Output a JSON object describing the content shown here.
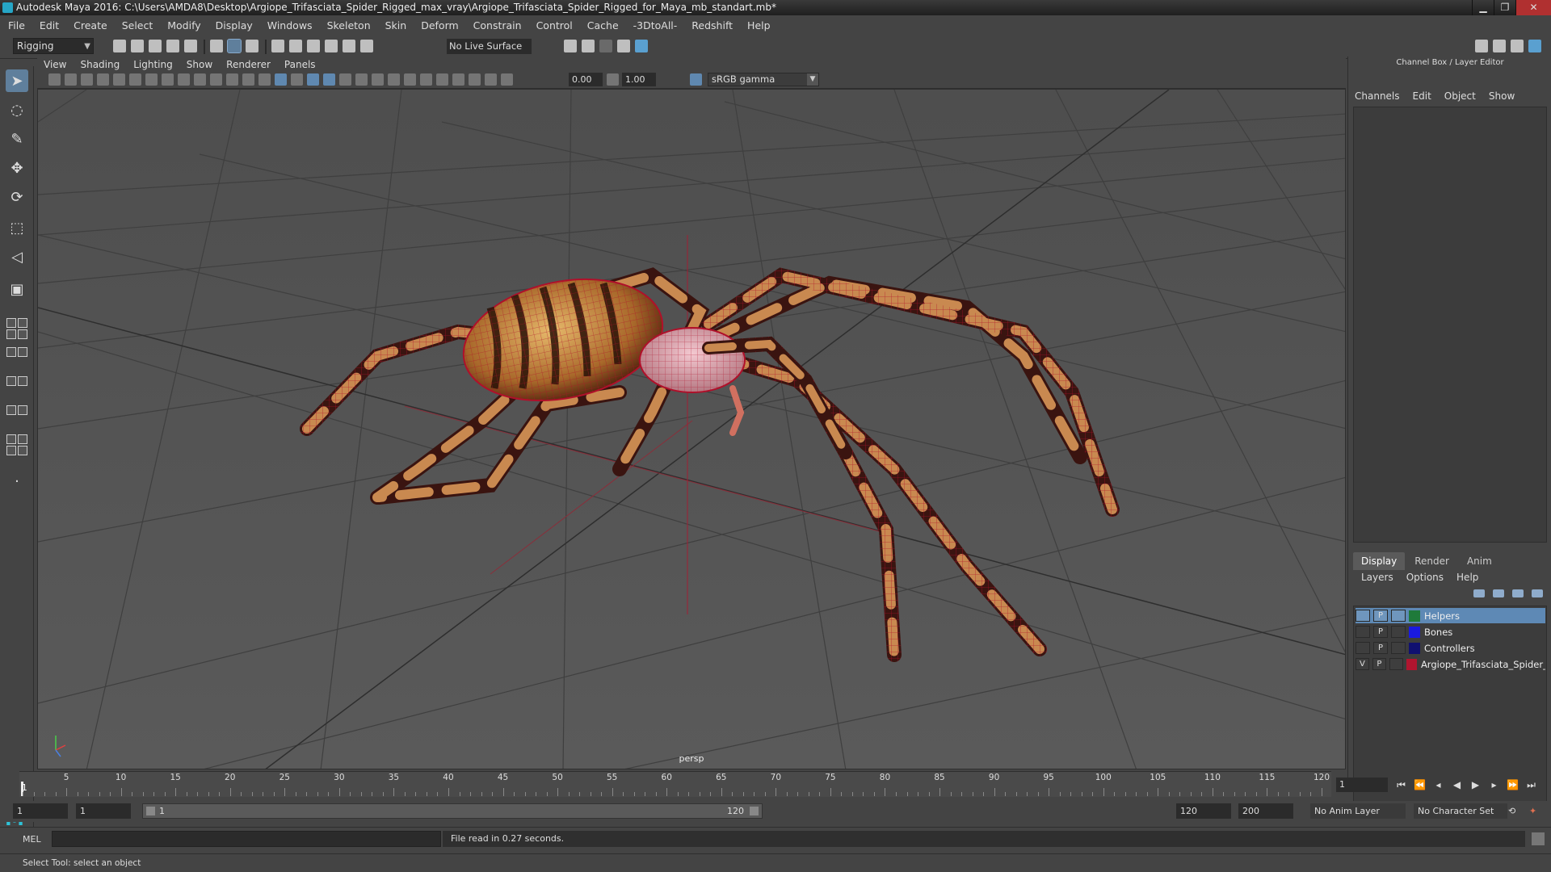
{
  "window": {
    "title": "Autodesk Maya 2016: C:\\Users\\AMDA8\\Desktop\\Argiope_Trifasciata_Spider_Rigged_max_vray\\Argiope_Trifasciata_Spider_Rigged_for_Maya_mb_standart.mb*",
    "minimize": "▁",
    "maximize": "❐",
    "close": "✕"
  },
  "menubar": [
    "File",
    "Edit",
    "Create",
    "Select",
    "Modify",
    "Display",
    "Windows",
    "Skeleton",
    "Skin",
    "Deform",
    "Constrain",
    "Control",
    "Cache",
    "-3DtoAll-",
    "Redshift",
    "Help"
  ],
  "statusline": {
    "mode": "Rigging",
    "live_surface": "No Live Surface"
  },
  "panel": {
    "menus": [
      "View",
      "Shading",
      "Lighting",
      "Show",
      "Renderer",
      "Panels"
    ],
    "exposure": "0.00",
    "gamma_value": "1.00",
    "color_space": "sRGB gamma",
    "camera_label": "persp"
  },
  "channel_box": {
    "title": "Channel Box / Layer Editor",
    "menus": [
      "Channels",
      "Edit",
      "Object",
      "Show"
    ]
  },
  "layer_editor": {
    "tabs": [
      "Display",
      "Render",
      "Anim"
    ],
    "active_tab": "Display",
    "menus": [
      "Layers",
      "Options",
      "Help"
    ],
    "layers": [
      {
        "v": "",
        "p": "P",
        "name": "Helpers",
        "color": "#1f7a3a",
        "selected": true
      },
      {
        "v": "",
        "p": "P",
        "name": "Bones",
        "color": "#1a1ae0",
        "selected": false
      },
      {
        "v": "",
        "p": "P",
        "name": "Controllers",
        "color": "#101070",
        "selected": false
      },
      {
        "v": "V",
        "p": "P",
        "name": "Argiope_Trifasciata_Spider_R",
        "color": "#b0152f",
        "selected": false
      }
    ]
  },
  "timeslider": {
    "ticks": [
      "5",
      "10",
      "15",
      "20",
      "25",
      "30",
      "35",
      "40",
      "45",
      "50",
      "55",
      "60",
      "65",
      "70",
      "75",
      "80",
      "85",
      "90",
      "95",
      "100",
      "105",
      "110",
      "115",
      "120"
    ],
    "current_frame_label": "1",
    "current_frame_field": "1"
  },
  "range": {
    "start": "1",
    "playback_start": "1",
    "range_left": "1",
    "range_right": "120",
    "playback_end": "120",
    "end": "200",
    "anim_layer": "No Anim Layer",
    "character_set": "No Character Set"
  },
  "cmdline": {
    "label": "MEL",
    "result": "File read in  0.27 seconds."
  },
  "helpline": "Select Tool: select an object"
}
